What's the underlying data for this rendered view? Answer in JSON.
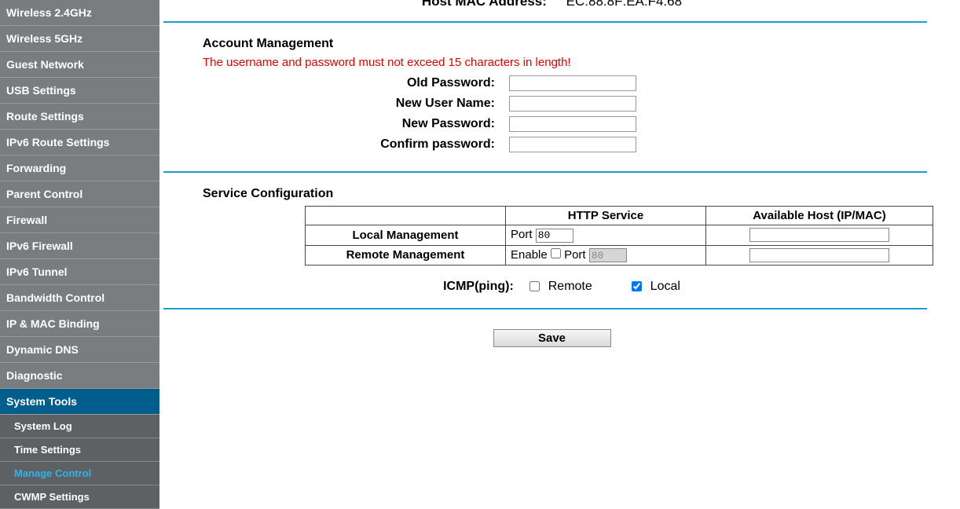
{
  "header": {
    "label": "Host MAC Address:",
    "value": "EC:88:8F:EA:F4:68"
  },
  "sidebar": {
    "items": [
      {
        "label": "Wireless 2.4GHz"
      },
      {
        "label": "Wireless 5GHz"
      },
      {
        "label": "Guest Network"
      },
      {
        "label": "USB Settings"
      },
      {
        "label": "Route Settings"
      },
      {
        "label": "IPv6 Route Settings"
      },
      {
        "label": "Forwarding"
      },
      {
        "label": "Parent Control"
      },
      {
        "label": "Firewall"
      },
      {
        "label": "IPv6 Firewall"
      },
      {
        "label": "IPv6 Tunnel"
      },
      {
        "label": "Bandwidth Control"
      },
      {
        "label": "IP & MAC Binding"
      },
      {
        "label": "Dynamic DNS"
      },
      {
        "label": "Diagnostic"
      },
      {
        "label": "System Tools",
        "active": true
      }
    ],
    "subitems": [
      {
        "label": "System Log"
      },
      {
        "label": "Time Settings"
      },
      {
        "label": "Manage Control",
        "highlighted": true
      },
      {
        "label": "CWMP Settings"
      }
    ]
  },
  "account": {
    "title": "Account Management",
    "warning": "The username and password must not exceed 15 characters in length!",
    "old_password_label": "Old Password:",
    "new_username_label": "New User Name:",
    "new_password_label": "New Password:",
    "confirm_password_label": "Confirm password:",
    "old_password": "",
    "new_username": "",
    "new_password": "",
    "confirm_password": ""
  },
  "service": {
    "title": "Service Configuration",
    "headers": {
      "blank": "",
      "http": "HTTP Service",
      "host": "Available Host (IP/MAC)"
    },
    "rows": {
      "local": {
        "label": "Local Management",
        "port_label": "Port",
        "port": "80",
        "host": ""
      },
      "remote": {
        "label": "Remote Management",
        "enable_label": "Enable",
        "enable": false,
        "port_label": "Port",
        "port": "80",
        "host": ""
      }
    },
    "icmp": {
      "label": "ICMP(ping):",
      "remote_label": "Remote",
      "remote": false,
      "local_label": "Local",
      "local": true
    }
  },
  "save_label": "Save"
}
